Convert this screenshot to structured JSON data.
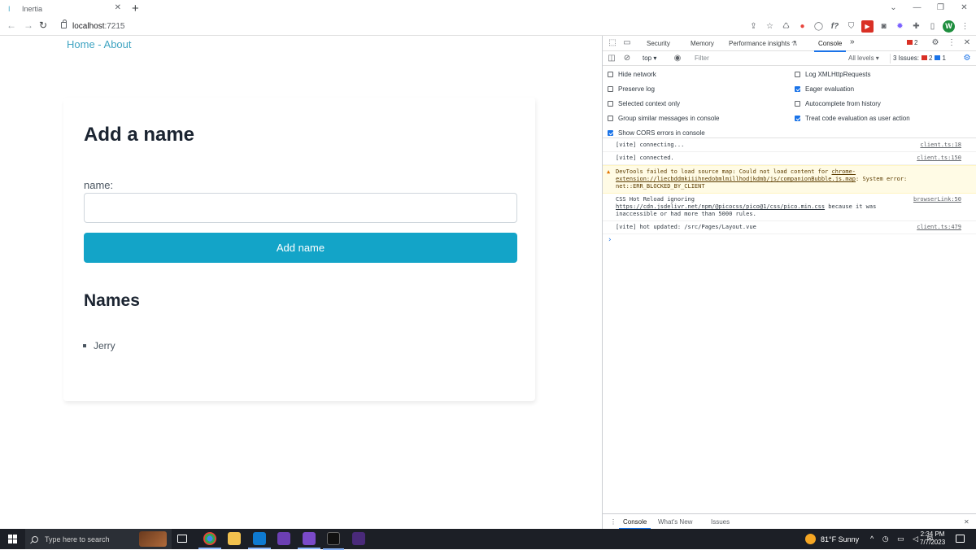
{
  "browser": {
    "tab_title": "Inertia",
    "tab_favicon": "I",
    "url_host": "localhost",
    "url_port": ":7215",
    "avatar_letter": "W"
  },
  "page": {
    "nav_home": "Home",
    "nav_sep": " - ",
    "nav_about": "About",
    "heading": "Add a name",
    "input_label": "name:",
    "input_value": "",
    "button_label": "Add name",
    "list_heading": "Names",
    "names": [
      "Jerry"
    ]
  },
  "devtools": {
    "tabs": [
      "Security",
      "Memory",
      "Performance insights",
      "Console"
    ],
    "active_tab": "Console",
    "error_count": "2",
    "context": "top",
    "filter_placeholder": "Filter",
    "levels": "All levels",
    "issues_label": "3 Issues:",
    "issues_errors": "2",
    "issues_info": "1",
    "options_left": [
      {
        "label": "Hide network",
        "checked": false
      },
      {
        "label": "Preserve log",
        "checked": false
      },
      {
        "label": "Selected context only",
        "checked": false
      },
      {
        "label": "Group similar messages in console",
        "checked": false
      },
      {
        "label": "Show CORS errors in console",
        "checked": true
      }
    ],
    "options_right": [
      {
        "label": "Log XMLHttpRequests",
        "checked": false
      },
      {
        "label": "Eager evaluation",
        "checked": true
      },
      {
        "label": "Autocomplete from history",
        "checked": false
      },
      {
        "label": "Treat code evaluation as user action",
        "checked": true
      }
    ],
    "console": {
      "line1": {
        "text": "[vite] connecting...",
        "src": "client.ts:18"
      },
      "line2": {
        "text": "[vite] connected.",
        "src": "client.ts:150"
      },
      "warn": {
        "pre": "DevTools failed to load source map: Could not load content for ",
        "link": "chrome-extension://liecbddmkiiihnedobmlmillhodjkdmb/js/companionBubble.js.map",
        "post": ": System error: net::ERR_BLOCKED_BY_CLIENT"
      },
      "line4": {
        "pre": "CSS Hot Reload ignoring ",
        "link": "https://cdn.jsdelivr.net/npm/@picocss/pico@1/css/pico.min.css",
        "post": " because it was inaccessible or had more than 5000 rules.",
        "src": "browserLink:50"
      },
      "line5": {
        "text": "[vite] hot updated: /src/Pages/Layout.vue",
        "src": "client.ts:479"
      }
    },
    "drawer_tabs": [
      "Console",
      "What's New",
      "Issues"
    ]
  },
  "taskbar": {
    "search_placeholder": "Type here to search",
    "weather": "81°F  Sunny",
    "time": "2:34 PM",
    "date": "7/7/2023"
  },
  "colors": {
    "link": "#3fa4c2",
    "button": "#13a4c8",
    "devtools_accent": "#1a73e8"
  }
}
